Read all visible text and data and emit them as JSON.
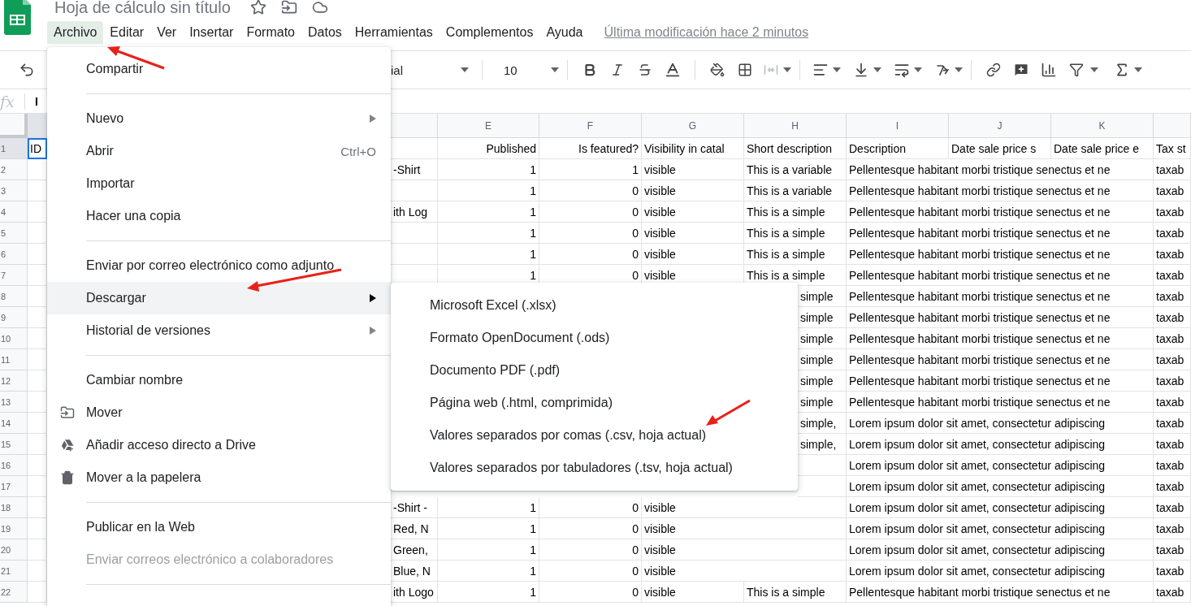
{
  "app": {
    "title": "Hoja de cálculo sin título",
    "last_edit": "Última modificación hace 2 minutos",
    "menus": [
      {
        "label": "Archivo",
        "selected": true
      },
      {
        "label": "Editar",
        "selected": false
      },
      {
        "label": "Ver",
        "selected": false
      },
      {
        "label": "Insertar",
        "selected": false
      },
      {
        "label": "Formato",
        "selected": false
      },
      {
        "label": "Datos",
        "selected": false
      },
      {
        "label": "Herramientas",
        "selected": false
      },
      {
        "label": "Complementos",
        "selected": false
      },
      {
        "label": "Ayuda",
        "selected": false
      }
    ]
  },
  "toolbar": {
    "font": "ial",
    "font_size": "10"
  },
  "formula_bar": {
    "label": "fx",
    "value": "I"
  },
  "columns": [
    {
      "selected": true,
      "kind": "text"
    },
    {
      "selected": false,
      "kind": "text"
    },
    {
      "label": "E",
      "selected": false,
      "kind": "number"
    },
    {
      "label": "F",
      "selected": false,
      "kind": "number"
    },
    {
      "label": "G",
      "selected": false,
      "kind": "text"
    },
    {
      "label": "H",
      "selected": false,
      "kind": "text"
    },
    {
      "label": "I",
      "selected": false,
      "kind": "text"
    },
    {
      "label": "J",
      "selected": false,
      "kind": "text"
    },
    {
      "label": "K",
      "selected": false,
      "kind": "text"
    },
    {
      "selected": false,
      "kind": "text"
    }
  ],
  "rows": [
    {
      "number": "1",
      "selected": true,
      "cells": [
        "ID",
        null,
        "Published",
        "Is featured?",
        "Visibility in catal",
        "Short description",
        "Description",
        "Date sale price s",
        "Date sale price e",
        "Tax st"
      ]
    },
    {
      "number": "2",
      "selected": false,
      "cells": [
        null,
        "-Shirt",
        "1",
        "1",
        "visible",
        "This is a variable",
        "Pellentesque habitant morbi tristique senectus et ne",
        null,
        null,
        "taxab"
      ]
    },
    {
      "number": "3",
      "selected": false,
      "cells": [
        null,
        null,
        "1",
        "0",
        "visible",
        "This is a variable",
        "Pellentesque habitant morbi tristique senectus et ne",
        null,
        null,
        "taxab"
      ]
    },
    {
      "number": "4",
      "selected": false,
      "cells": [
        null,
        "ith Log",
        "1",
        "0",
        "visible",
        "This is a simple",
        "Pellentesque habitant morbi tristique senectus et ne",
        null,
        null,
        "taxab"
      ]
    },
    {
      "number": "5",
      "selected": false,
      "cells": [
        null,
        null,
        "1",
        "0",
        "visible",
        "This is a simple",
        "Pellentesque habitant morbi tristique senectus et ne",
        null,
        null,
        "taxab"
      ]
    },
    {
      "number": "6",
      "selected": false,
      "cells": [
        null,
        null,
        "1",
        "0",
        "visible",
        "This is a simple",
        "Pellentesque habitant morbi tristique senectus et ne",
        null,
        null,
        "taxab"
      ]
    },
    {
      "number": "7",
      "selected": false,
      "cells": [
        null,
        null,
        "1",
        "0",
        "visible",
        "This is a simple",
        "Pellentesque habitant morbi tristique senectus et ne",
        null,
        null,
        "taxab"
      ]
    },
    {
      "number": "8",
      "selected": false,
      "cells": [
        null,
        null,
        null,
        null,
        null,
        "simple",
        "Pellentesque habitant morbi tristique senectus et ne",
        null,
        null,
        "taxab"
      ]
    },
    {
      "number": "9",
      "selected": false,
      "cells": [
        null,
        null,
        null,
        null,
        null,
        "simple",
        "Pellentesque habitant morbi tristique senectus et ne",
        null,
        null,
        "taxab"
      ]
    },
    {
      "number": "10",
      "selected": false,
      "cells": [
        null,
        null,
        null,
        null,
        null,
        "simple",
        "Pellentesque habitant morbi tristique senectus et ne",
        null,
        null,
        "taxab"
      ]
    },
    {
      "number": "11",
      "selected": false,
      "cells": [
        null,
        null,
        null,
        null,
        null,
        "simple",
        "Pellentesque habitant morbi tristique senectus et ne",
        null,
        null,
        "taxab"
      ]
    },
    {
      "number": "12",
      "selected": false,
      "cells": [
        null,
        null,
        null,
        null,
        null,
        "simple",
        "Pellentesque habitant morbi tristique senectus et ne",
        null,
        null,
        "taxab"
      ]
    },
    {
      "number": "13",
      "selected": false,
      "cells": [
        null,
        null,
        null,
        null,
        null,
        "simple",
        "Pellentesque habitant morbi tristique senectus et ne",
        null,
        null,
        "taxab"
      ]
    },
    {
      "number": "14",
      "selected": false,
      "cells": [
        null,
        null,
        null,
        null,
        null,
        "simple,",
        "Lorem ipsum dolor sit amet, consectetur adipiscing",
        null,
        null,
        "taxab"
      ]
    },
    {
      "number": "15",
      "selected": false,
      "cells": [
        null,
        null,
        null,
        null,
        null,
        "simple,",
        "Lorem ipsum dolor sit amet, consectetur adipiscing",
        null,
        null,
        "taxab"
      ]
    },
    {
      "number": "16",
      "selected": false,
      "cells": [
        null,
        null,
        null,
        null,
        null,
        null,
        "Lorem ipsum dolor sit amet, consectetur adipiscing",
        null,
        null,
        "taxab"
      ]
    },
    {
      "number": "17",
      "selected": false,
      "cells": [
        null,
        null,
        null,
        null,
        null,
        null,
        "Lorem ipsum dolor sit amet, consectetur adipiscing",
        null,
        null,
        "taxab"
      ]
    },
    {
      "number": "18",
      "selected": false,
      "cells": [
        null,
        "-Shirt -",
        "1",
        "0",
        "visible",
        null,
        "Lorem ipsum dolor sit amet, consectetur adipiscing",
        null,
        null,
        "taxab"
      ]
    },
    {
      "number": "19",
      "selected": false,
      "cells": [
        null,
        "Red, N",
        "1",
        "0",
        "visible",
        null,
        "Lorem ipsum dolor sit amet, consectetur adipiscing",
        null,
        null,
        "taxab"
      ]
    },
    {
      "number": "20",
      "selected": false,
      "cells": [
        null,
        "Green,",
        "1",
        "0",
        "visible",
        null,
        "Lorem ipsum dolor sit amet, consectetur adipiscing",
        null,
        null,
        "taxab"
      ]
    },
    {
      "number": "21",
      "selected": false,
      "cells": [
        null,
        "Blue, N",
        "1",
        "0",
        "visible",
        null,
        "Lorem ipsum dolor sit amet, consectetur adipiscing",
        null,
        null,
        "taxab"
      ]
    },
    {
      "number": "22",
      "selected": false,
      "cells": [
        null,
        "ith Logo",
        "1",
        "0",
        "visible",
        "This is a simple",
        "Pellentesque habitant morbi tristique senectus et ne",
        null,
        null,
        "taxab"
      ]
    }
  ],
  "file_menu": {
    "items": [
      {
        "kind": "item",
        "label": "Compartir",
        "submenu": false,
        "selected": false,
        "disabled": false
      },
      {
        "kind": "separator"
      },
      {
        "kind": "item",
        "label": "Nuevo",
        "submenu": true,
        "selected": false,
        "disabled": false
      },
      {
        "kind": "item",
        "label": "Abrir",
        "shortcut": "Ctrl+O",
        "submenu": false,
        "selected": false,
        "disabled": false
      },
      {
        "kind": "item",
        "label": "Importar",
        "submenu": false,
        "selected": false,
        "disabled": false
      },
      {
        "kind": "item",
        "label": "Hacer una copia",
        "submenu": false,
        "selected": false,
        "disabled": false
      },
      {
        "kind": "separator"
      },
      {
        "kind": "item",
        "label": "Enviar por correo electrónico como adjunto",
        "submenu": false,
        "selected": false,
        "disabled": false
      },
      {
        "kind": "item",
        "label": "Descargar",
        "submenu": true,
        "selected": true,
        "disabled": false
      },
      {
        "kind": "item",
        "label": "Historial de versiones",
        "submenu": true,
        "selected": false,
        "disabled": false
      },
      {
        "kind": "separator"
      },
      {
        "kind": "item",
        "label": "Cambiar nombre",
        "submenu": false,
        "selected": false,
        "disabled": false
      },
      {
        "kind": "item",
        "label": "Mover",
        "submenu": false,
        "selected": false,
        "disabled": false
      },
      {
        "kind": "item",
        "label": "Añadir acceso directo a Drive",
        "submenu": false,
        "selected": false,
        "disabled": false
      },
      {
        "kind": "item",
        "label": "Mover a la papelera",
        "submenu": false,
        "selected": false,
        "disabled": false
      },
      {
        "kind": "separator"
      },
      {
        "kind": "item",
        "label": "Publicar en la Web",
        "submenu": false,
        "selected": false,
        "disabled": false
      },
      {
        "kind": "item",
        "label": "Enviar correos electrónico a colaboradores",
        "submenu": false,
        "selected": false,
        "disabled": true
      },
      {
        "kind": "separator"
      }
    ]
  },
  "download_menu": {
    "items": [
      {
        "label": "Microsoft Excel (.xlsx)"
      },
      {
        "label": "Formato OpenDocument (.ods)"
      },
      {
        "label": "Documento PDF (.pdf)"
      },
      {
        "label": "Página web (.html, comprimida)"
      },
      {
        "label": "Valores separados por comas (.csv, hoja actual)"
      },
      {
        "label": "Valores separados por tabuladores (.tsv, hoja actual)"
      }
    ]
  }
}
